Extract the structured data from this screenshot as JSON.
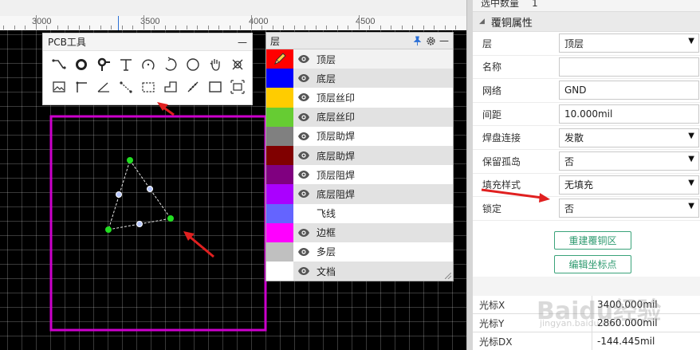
{
  "ruler": {
    "labels": [
      "3000",
      "3500",
      "4000",
      "4500"
    ]
  },
  "pcb_tools": {
    "title": "PCB工具",
    "minimize": "—",
    "tools": [
      "track-icon",
      "pad-icon",
      "via-icon",
      "text-icon",
      "arc-icon",
      "arc-center-icon",
      "circle-icon",
      "pan-hand-icon",
      "clear-cross-icon",
      "image-icon",
      "dimension-icon",
      "angle-icon",
      "connect-icon",
      "copper-area-icon",
      "solid-region-icon",
      "measure-icon",
      "rectangle-icon",
      "select-frame-icon"
    ]
  },
  "layers": {
    "title": "层",
    "minimize": "—",
    "items": [
      {
        "name": "顶层",
        "color": "#ff0000",
        "eye": true,
        "editing": true
      },
      {
        "name": "底层",
        "color": "#0000ff",
        "eye": true
      },
      {
        "name": "顶层丝印",
        "color": "#ffcc00",
        "eye": true
      },
      {
        "name": "底层丝印",
        "color": "#66cc33",
        "eye": true
      },
      {
        "name": "顶层助焊",
        "color": "#808080",
        "eye": true
      },
      {
        "name": "底层助焊",
        "color": "#800000",
        "eye": true
      },
      {
        "name": "顶层阻焊",
        "color": "#800080",
        "eye": true
      },
      {
        "name": "底层阻焊",
        "color": "#aa00ff",
        "eye": true
      },
      {
        "name": "飞线",
        "color": "#6464ff",
        "eye": false
      },
      {
        "name": "边框",
        "color": "#ff00ff",
        "eye": true
      },
      {
        "name": "多层",
        "color": "#c0c0c0",
        "eye": true
      },
      {
        "name": "文档",
        "color": "#ffffff",
        "eye": true
      }
    ]
  },
  "properties": {
    "selected_count_label": "选中数量",
    "selected_count": "1",
    "section_title": "覆铜属性",
    "rows": [
      {
        "label": "层",
        "value": "顶层",
        "dropdown": true
      },
      {
        "label": "名称",
        "value": "",
        "dropdown": false
      },
      {
        "label": "网络",
        "value": "GND",
        "dropdown": false
      },
      {
        "label": "间距",
        "value": "10.000mil",
        "dropdown": false
      },
      {
        "label": "焊盘连接",
        "value": "发散",
        "dropdown": true
      },
      {
        "label": "保留孤岛",
        "value": "否",
        "dropdown": true
      },
      {
        "label": "填充样式",
        "value": "无填充",
        "dropdown": true
      },
      {
        "label": "锁定",
        "value": "否",
        "dropdown": true
      }
    ],
    "rebuild_button": "重建覆铜区",
    "edit_coords_button": "编辑坐标点"
  },
  "cursor": {
    "rows": [
      {
        "label": "光标X",
        "value": "3400.000mil"
      },
      {
        "label": "光标Y",
        "value": "2860.000mil"
      },
      {
        "label": "光标DX",
        "value": "-144.445mil"
      }
    ]
  },
  "watermark": {
    "text": "Baidu经验",
    "sub": "jingyan.baidu.com"
  },
  "colors": {
    "board_outline": "#cc00cc",
    "arrow": "#e02020",
    "vertex": "#22dd22",
    "midpoint": "#b8c8ff"
  }
}
